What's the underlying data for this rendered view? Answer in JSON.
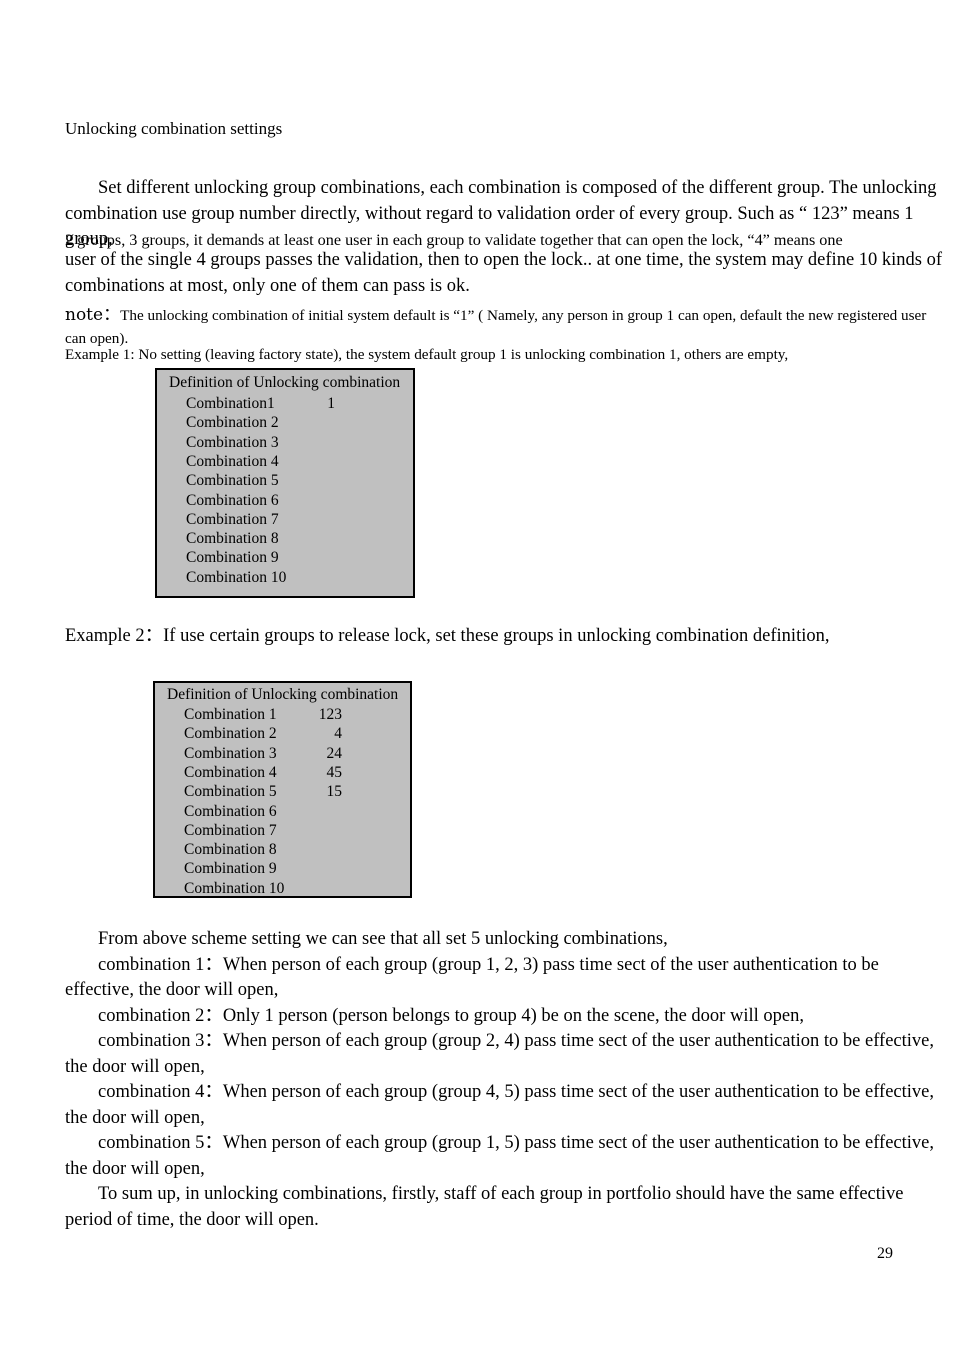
{
  "document": {
    "heading": "Unlocking combination settings",
    "page_number": "29",
    "intro_paragraph": "Set different unlocking group combinations, each combination is composed of the different group. The unlocking combination use group number directly, without regard to validation order of every group. Such as “ 123” means 1 group,",
    "intro_continuation_1": "2 groups, 3 groups, it demands at least one user in each group to validate together that can open the lock, “4” means one",
    "intro_continuation_2": "user of the single 4 groups passes the validation, then to open the lock.. at one time, the system may define 10 kinds of combinations at most, only one of them can pass is ok.",
    "note_label": "note：",
    "note_text": "The unlocking combination of initial system default is “1” ( Namely, any person in group 1 can open, default the new registered user can open).",
    "example1_line": "Example 1: No setting (leaving factory state), the system default group 1 is unlocking combination 1, others are empty,",
    "example2_line": "Example 2：If use certain groups to release lock, set these groups in unlocking combination definition,"
  },
  "definition_box_1": {
    "title": "Definition of Unlocking combination",
    "rows": [
      {
        "label": "Combination1",
        "value": "1"
      },
      {
        "label": "Combination 2",
        "value": ""
      },
      {
        "label": "Combination 3",
        "value": ""
      },
      {
        "label": "Combination 4",
        "value": ""
      },
      {
        "label": "Combination 5",
        "value": ""
      },
      {
        "label": "Combination 6",
        "value": ""
      },
      {
        "label": "Combination 7",
        "value": ""
      },
      {
        "label": "Combination 8",
        "value": ""
      },
      {
        "label": "Combination 9",
        "value": ""
      },
      {
        "label": "Combination 10",
        "value": ""
      }
    ]
  },
  "definition_box_2": {
    "title": "Definition of Unlocking combination",
    "rows": [
      {
        "label": "Combination 1",
        "value": "123"
      },
      {
        "label": "Combination 2",
        "value": "4"
      },
      {
        "label": "Combination 3",
        "value": "24"
      },
      {
        "label": "Combination 4",
        "value": "45"
      },
      {
        "label": "Combination 5",
        "value": "15"
      },
      {
        "label": "Combination 6",
        "value": ""
      },
      {
        "label": "Combination 7",
        "value": ""
      },
      {
        "label": "Combination 8",
        "value": ""
      },
      {
        "label": "Combination 9",
        "value": ""
      },
      {
        "label": "Combination 10",
        "value": ""
      }
    ]
  },
  "closing": {
    "summary_intro": "From above scheme setting we can see that all set 5 unlocking combinations,",
    "combination_1": "combination 1：When person of each group (group 1, 2, 3) pass time sect of the user authentication to be effective, the door will open,",
    "combination_2": "combination 2：Only 1 person (person belongs to group 4) be on the scene, the door will open,",
    "combination_3": "combination 3：When person of each group (group 2, 4) pass time sect of the user authentication to be effective, the door will open,",
    "combination_4": "combination 4：When person of each group (group 4, 5) pass time sect of the user authentication to be effective, the door will open,",
    "combination_5": "combination 5：When person of each group (group 1, 5) pass time sect of the user authentication to be effective, the door will open,",
    "conclusion": "To sum up, in unlocking combinations, firstly, staff of each group in portfolio should have the same effective period of time, the door will open."
  },
  "colors": {
    "box_fill": "#c0c0c0",
    "box_border": "#000000",
    "page_background": "#ffffff",
    "text": "#000000"
  }
}
